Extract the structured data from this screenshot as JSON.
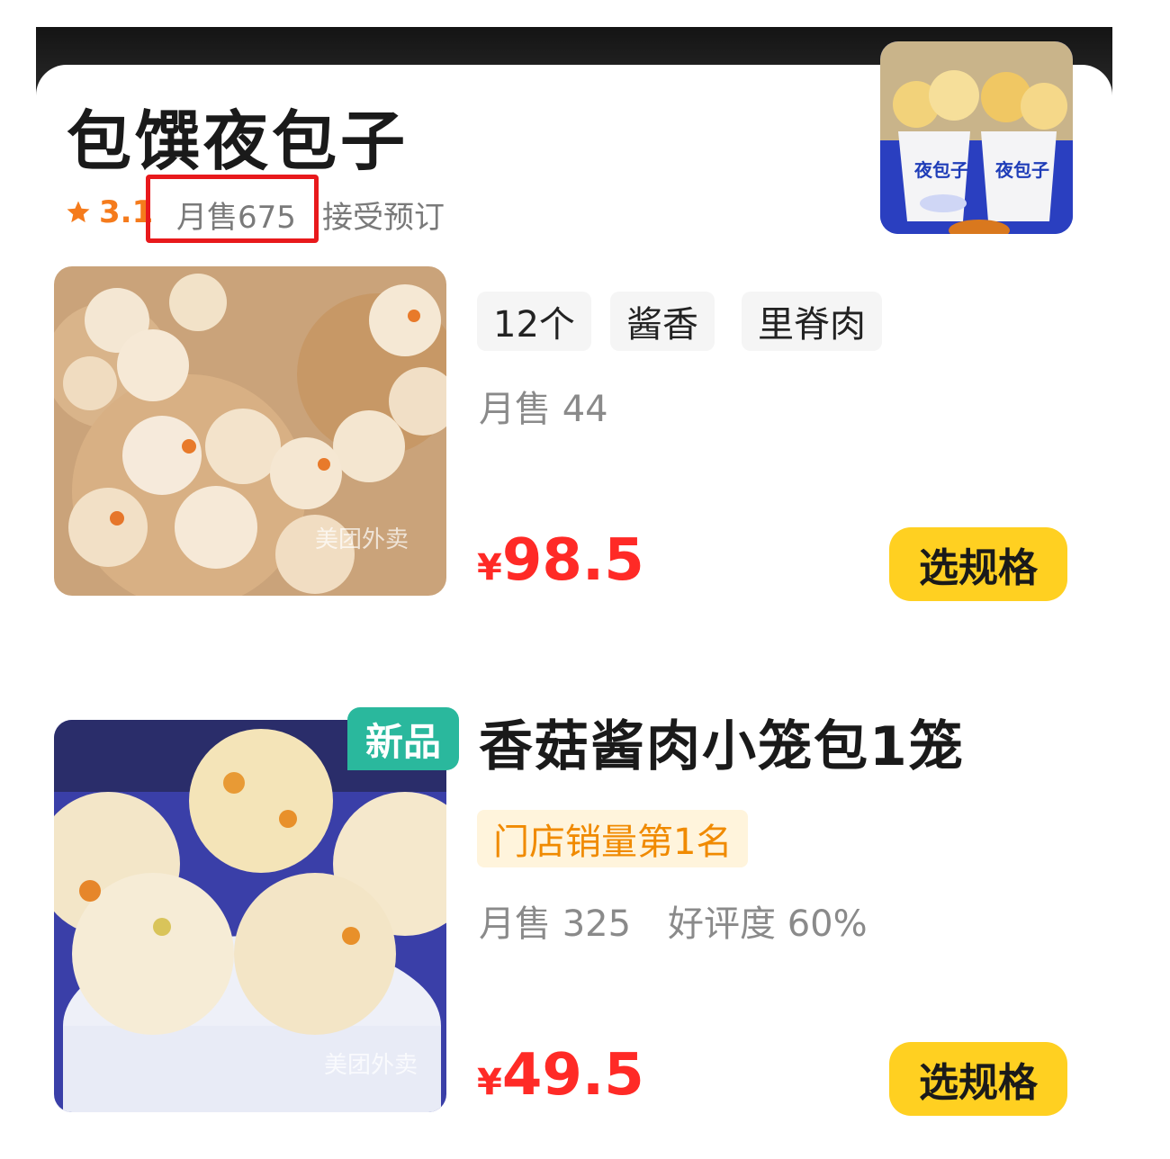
{
  "store": {
    "name": "包馔夜包子",
    "rating": "3.1",
    "monthly_sales": "月售675",
    "accept_order": "接受预订",
    "thumb_text": "夜包子"
  },
  "items": [
    {
      "tags": [
        "12个",
        "酱香",
        "里脊肉"
      ],
      "sales": "月售 44",
      "currency": "¥",
      "price": "98.5",
      "spec_label": "选规格",
      "watermark": "美团外卖"
    },
    {
      "badge": "新品",
      "title": "香菇酱肉小笼包1笼",
      "rank": "门店销量第1名",
      "sales": "月售 325",
      "rating": "好评度 60%",
      "currency": "¥",
      "price": "49.5",
      "spec_label": "选规格",
      "watermark": "美团外卖"
    }
  ],
  "colors": {
    "accent_yellow": "#ffd021",
    "price_red": "#ff2a26",
    "rating_orange": "#f57b1c",
    "highlight_red": "#e8191c",
    "new_badge_green": "#2ab89d"
  }
}
